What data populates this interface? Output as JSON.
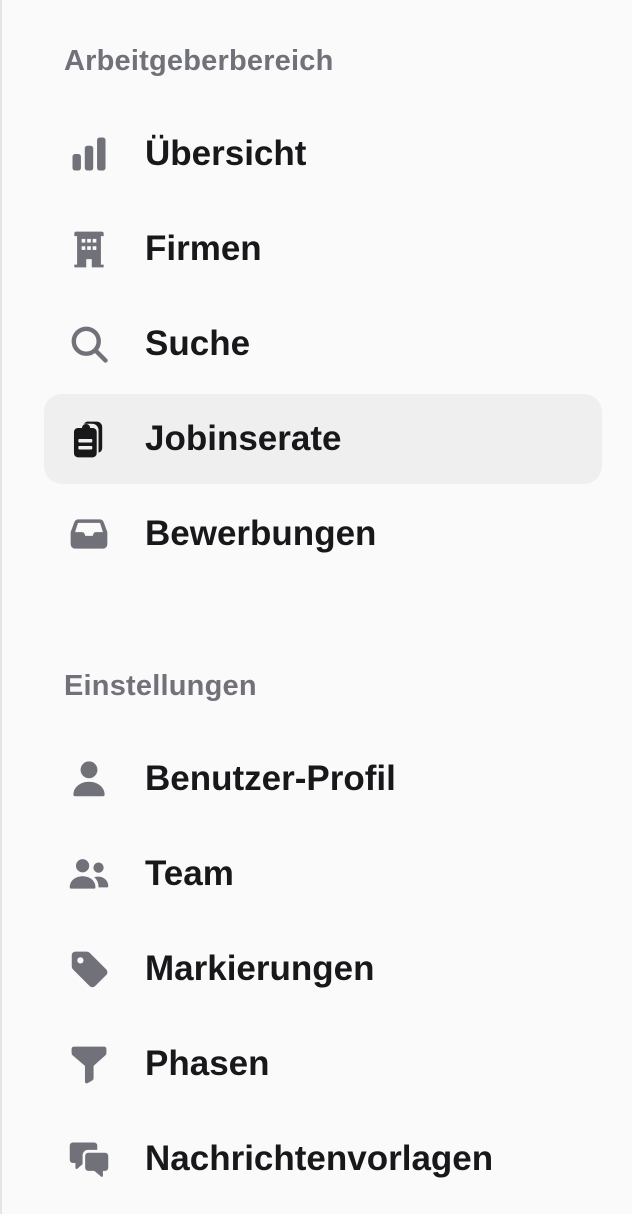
{
  "colors": {
    "background": "#fafafa",
    "active_background": "#efefef",
    "section_title": "#71717a",
    "icon": "#71717a",
    "icon_active": "#18181b",
    "label": "#18181b"
  },
  "sections": [
    {
      "title": "Arbeitgeberbereich",
      "items": [
        {
          "label": "Übersicht",
          "icon": "bar-chart-icon",
          "active": false
        },
        {
          "label": "Firmen",
          "icon": "building-icon",
          "active": false
        },
        {
          "label": "Suche",
          "icon": "search-icon",
          "active": false
        },
        {
          "label": "Jobinserate",
          "icon": "clipboard-documents-icon",
          "active": true
        },
        {
          "label": "Bewerbungen",
          "icon": "inbox-icon",
          "active": false
        }
      ]
    },
    {
      "title": "Einstellungen",
      "items": [
        {
          "label": "Benutzer-Profil",
          "icon": "user-icon",
          "active": false
        },
        {
          "label": "Team",
          "icon": "users-icon",
          "active": false
        },
        {
          "label": "Markierungen",
          "icon": "tag-icon",
          "active": false
        },
        {
          "label": "Phasen",
          "icon": "funnel-icon",
          "active": false
        },
        {
          "label": "Nachrichtenvorlagen",
          "icon": "chat-bubbles-icon",
          "active": false
        }
      ]
    }
  ]
}
